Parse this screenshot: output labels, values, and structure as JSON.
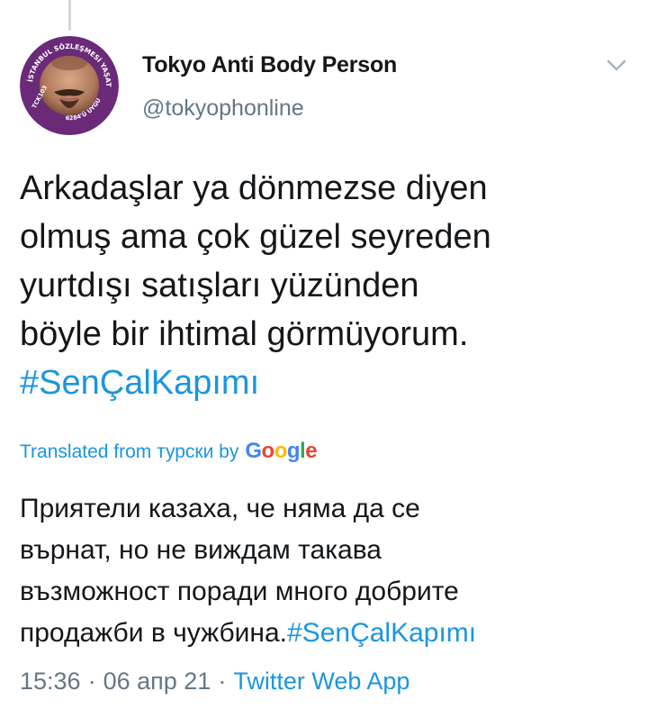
{
  "author": {
    "name": "Tokyo Anti Body Person",
    "handle": "@tokyophonline"
  },
  "avatar": {
    "ring_text_top": "İSTANBUL SÖZLEŞMESİ YAŞATIR",
    "ring_text_left": "TCK103",
    "ring_text_bottom": "6284'Ü UYGULA"
  },
  "tweet": {
    "lines": [
      "Arkadaşlar ya dönmezse diyen",
      "olmuş ama çok güzel seyreden",
      "yurtdışı satışları yüzünden",
      "böyle bir ihtimal görmüyorum."
    ],
    "hashtag": "#SenÇalKapımı"
  },
  "translation": {
    "label": "Translated from турски by",
    "provider": "Google",
    "lines": [
      "Приятели казаха, че няма да се",
      "върнат, но не виждам такава",
      "възможност поради много добрите"
    ],
    "last_line_text": "продажби в чужбина.",
    "last_line_hashtag": "#SenÇalKapımı"
  },
  "meta": {
    "time": "15:36",
    "separator": "·",
    "date": "06 апр 21",
    "source": "Twitter Web App"
  },
  "colors": {
    "link": "#1b95e0",
    "secondary_text": "#657786",
    "avatar_ring": "#6a2a78"
  },
  "icons": {
    "caret": "chevron-down-icon"
  }
}
